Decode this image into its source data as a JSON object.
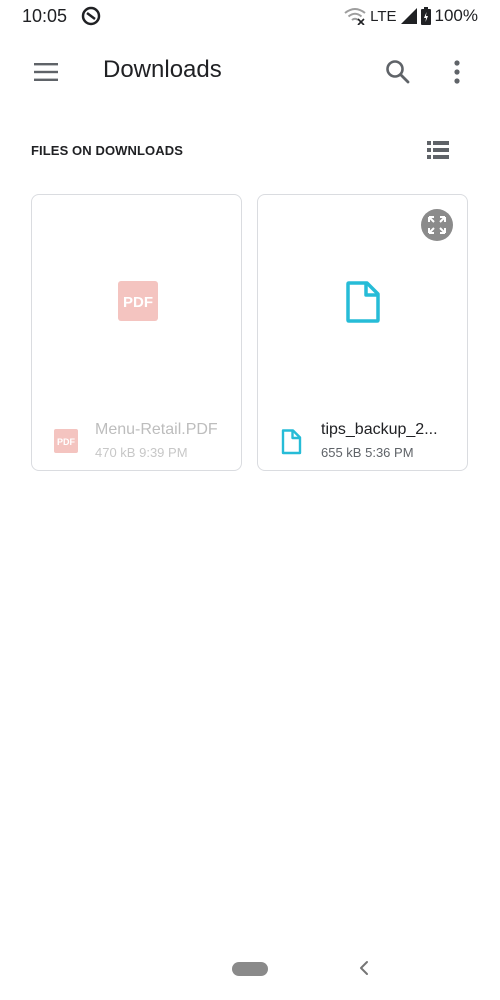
{
  "status": {
    "time": "10:05",
    "network": "LTE",
    "battery": "100%",
    "icons": [
      "data-saver-icon",
      "wifi-off-icon",
      "signal-icon",
      "battery-icon"
    ]
  },
  "appbar": {
    "title": "Downloads",
    "icons": [
      "menu-icon",
      "search-icon",
      "more-vert-icon"
    ]
  },
  "section": {
    "title": "FILES ON DOWNLOADS",
    "view_icon": "list-view-icon"
  },
  "files": [
    {
      "name": "Menu-Retail.PDF",
      "size": "470 kB",
      "time": "9:39 PM",
      "type_icon": "pdf-icon",
      "badge": "PDF",
      "color": "#f4c4c0",
      "dimmed": true
    },
    {
      "name": "tips_backup_2...",
      "size": "655 kB",
      "time": "5:36 PM",
      "type_icon": "file-icon",
      "color": "#26bcd7",
      "dimmed": false,
      "overlay_icon": "expand-icon"
    }
  ],
  "navbar": {
    "icons": [
      "home-pill",
      "back-icon"
    ]
  }
}
